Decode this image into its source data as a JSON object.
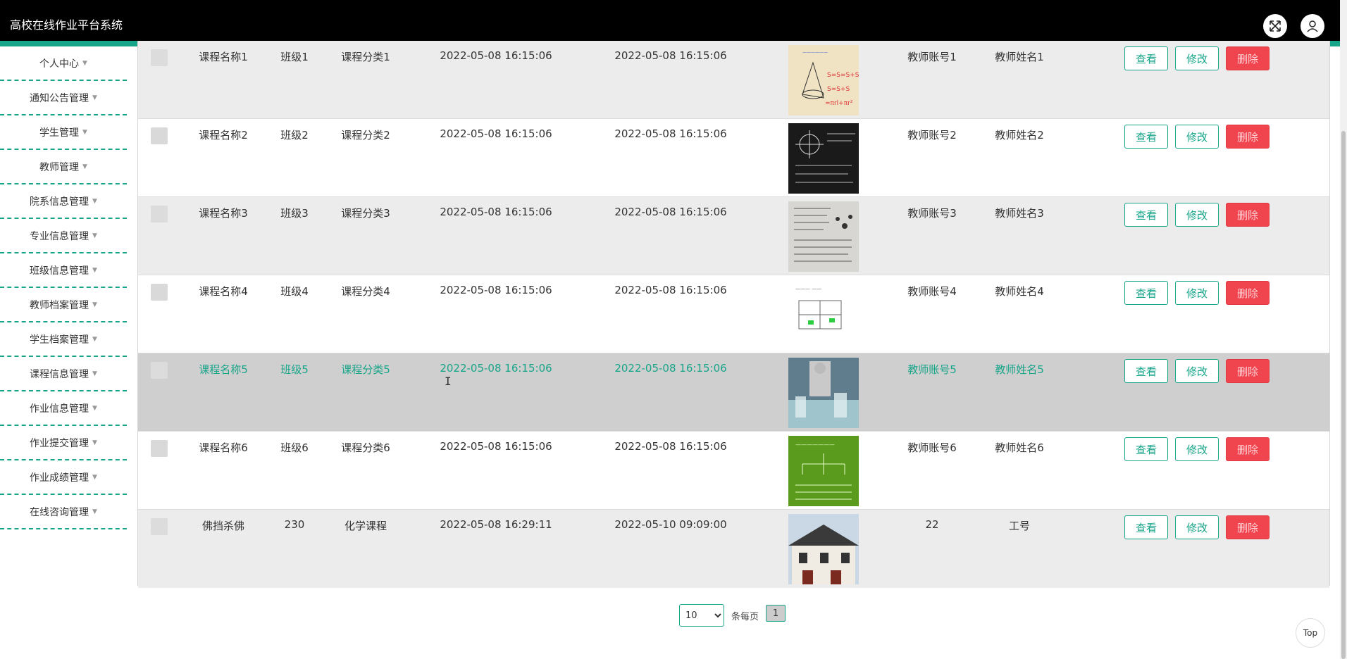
{
  "app": {
    "title": "高校在线作业平台系统"
  },
  "header": {
    "icons": {
      "fullscreen": "fullscreen-icon",
      "user": "user-icon"
    }
  },
  "sidebar": {
    "items": [
      {
        "label": "个人中心"
      },
      {
        "label": "通知公告管理"
      },
      {
        "label": "学生管理"
      },
      {
        "label": "教师管理"
      },
      {
        "label": "院系信息管理"
      },
      {
        "label": "专业信息管理"
      },
      {
        "label": "班级信息管理"
      },
      {
        "label": "教师档案管理"
      },
      {
        "label": "学生档案管理"
      },
      {
        "label": "课程信息管理"
      },
      {
        "label": "作业信息管理"
      },
      {
        "label": "作业提交管理"
      },
      {
        "label": "作业成绩管理"
      },
      {
        "label": "在线咨询管理"
      }
    ]
  },
  "table": {
    "actions": {
      "view": "查看",
      "edit": "修改",
      "delete": "删除"
    },
    "rows": [
      {
        "course": "课程名称1",
        "class": "班级1",
        "category": "课程分类1",
        "start": "2022-05-08 16:15:06",
        "end": "2022-05-08 16:15:06",
        "teacher_account": "教师账号1",
        "teacher_name": "教师姓名1"
      },
      {
        "course": "课程名称2",
        "class": "班级2",
        "category": "课程分类2",
        "start": "2022-05-08 16:15:06",
        "end": "2022-05-08 16:15:06",
        "teacher_account": "教师账号2",
        "teacher_name": "教师姓名2"
      },
      {
        "course": "课程名称3",
        "class": "班级3",
        "category": "课程分类3",
        "start": "2022-05-08 16:15:06",
        "end": "2022-05-08 16:15:06",
        "teacher_account": "教师账号3",
        "teacher_name": "教师姓名3"
      },
      {
        "course": "课程名称4",
        "class": "班级4",
        "category": "课程分类4",
        "start": "2022-05-08 16:15:06",
        "end": "2022-05-08 16:15:06",
        "teacher_account": "教师账号4",
        "teacher_name": "教师姓名4"
      },
      {
        "course": "课程名称5",
        "class": "班级5",
        "category": "课程分类5",
        "start": "2022-05-08 16:15:06",
        "end": "2022-05-08 16:15:06",
        "teacher_account": "教师账号5",
        "teacher_name": "教师姓名5"
      },
      {
        "course": "课程名称6",
        "class": "班级6",
        "category": "课程分类6",
        "start": "2022-05-08 16:15:06",
        "end": "2022-05-08 16:15:06",
        "teacher_account": "教师账号6",
        "teacher_name": "教师姓名6"
      },
      {
        "course": "佛挡杀佛",
        "class": "230",
        "category": "化学课程",
        "start": "2022-05-08 16:29:11",
        "end": "2022-05-10 09:09:00",
        "teacher_account": "22",
        "teacher_name": "工号"
      }
    ]
  },
  "pagination": {
    "page_size": "10",
    "page_size_options": [
      "10"
    ],
    "per_page_label": "条每页",
    "current_page": "1"
  },
  "back_to_top": "Top",
  "colors": {
    "accent": "#17a589",
    "delete": "#f0444f",
    "header": "#000000"
  }
}
